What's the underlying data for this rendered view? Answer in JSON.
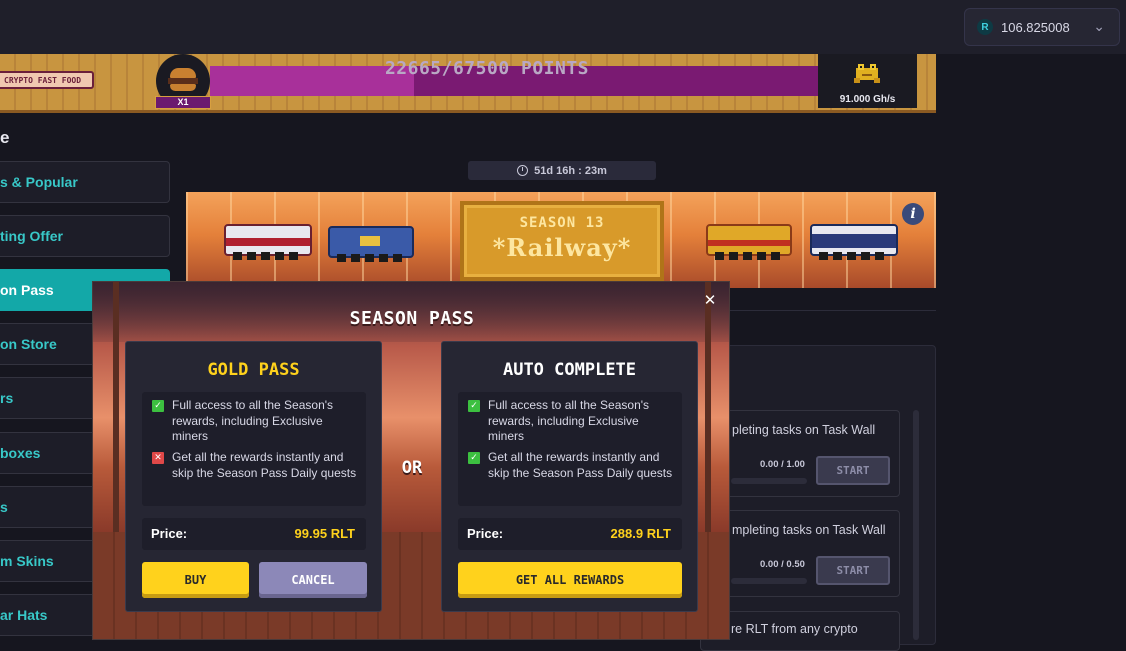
{
  "header": {
    "balance": "106.825008",
    "balance_currency_icon": "R"
  },
  "event_banner": {
    "badge": "CRYPTO FAST FOOD",
    "multiplier": "X1",
    "points": "22665/67500 POINTS",
    "points_progress_percent": 33.6,
    "power": "91.000 Gh/s"
  },
  "sidebar": {
    "section_title": "e",
    "items": [
      {
        "label": "s & Popular",
        "active": false
      },
      {
        "label": "ting Offer",
        "active": false
      },
      {
        "label": "on Pass",
        "active": true
      },
      {
        "label": "on Store",
        "active": false
      },
      {
        "label": "rs",
        "active": false
      },
      {
        "label": "boxes",
        "active": false
      },
      {
        "label": "s",
        "active": false
      },
      {
        "label": "m Skins",
        "active": false
      },
      {
        "label": "ar Hats",
        "active": false
      }
    ]
  },
  "season": {
    "timer": "51d 16h : 23m",
    "sign_top": "SEASON 13",
    "sign_main": "*Railway*"
  },
  "tasks": [
    {
      "text": "pleting tasks on Task Wall",
      "progress": "0.00 / 1.00",
      "button": "START"
    },
    {
      "text": "mpleting tasks on Task Wall",
      "progress": "0.00 / 0.50",
      "button": "START"
    },
    {
      "text": "re RLT from any crypto"
    }
  ],
  "modal": {
    "title": "SEASON PASS",
    "or_label": "OR",
    "gold_pass": {
      "title": "GOLD PASS",
      "title_color": "#ffd21c",
      "features": [
        {
          "text": "Full access to all the Season's rewards, including Exclusive miners",
          "included": true
        },
        {
          "text": "Get all the rewards instantly and skip the Season Pass Daily quests",
          "included": false
        }
      ],
      "price_label": "Price:",
      "price": "99.95 RLT",
      "buy_label": "BUY",
      "cancel_label": "CANCEL"
    },
    "auto_complete": {
      "title": "AUTO COMPLETE",
      "title_color": "#ffffff",
      "features": [
        {
          "text": "Full access to all the Season's rewards, including Exclusive miners",
          "included": true
        },
        {
          "text": "Get all the rewards instantly and skip the Season Pass Daily quests",
          "included": true
        }
      ],
      "price_label": "Price:",
      "price": "288.9 RLT",
      "cta_label": "GET ALL REWARDS"
    }
  },
  "colors": {
    "accent_teal": "#13a8a8",
    "price_yellow": "#ffd21c",
    "button_yellow": "#ffd21c",
    "button_purple": "#8c88b8",
    "check_green": "#3cc040",
    "cross_red": "#e04848"
  }
}
